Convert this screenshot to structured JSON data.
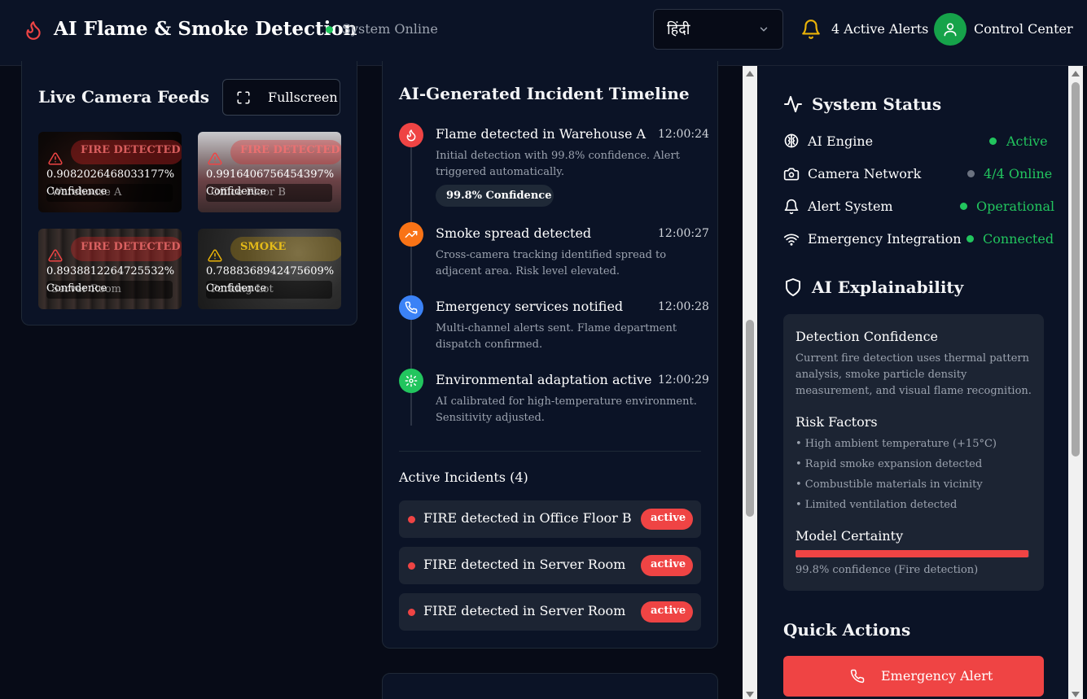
{
  "header": {
    "title": "AI Flame & Smoke Detection",
    "status": "System Online",
    "language": "हिंदी",
    "alerts": "4 Active Alerts",
    "user": "Control Center"
  },
  "cameras": {
    "title": "Live Camera Feeds",
    "fullscreen_label": "Fullscreen",
    "feeds": [
      {
        "badge": "FIRE DETECTED",
        "location": "Warehouse A",
        "confidence": "0.9082026468033177%",
        "confidence_label": "Confidence"
      },
      {
        "badge": "FIRE DETECTED",
        "location": "Office Floor B",
        "confidence": "0.9916406756454397%",
        "confidence_label": "Confidence"
      },
      {
        "badge": "FIRE DETECTED",
        "location": "Server Room",
        "confidence": "0.8938812264725532%",
        "confidence_label": "Confidence"
      },
      {
        "badge": "SMOKE",
        "location": "Parking Lot",
        "confidence": "0.7888368942475609%",
        "confidence_label": "Confidence"
      }
    ]
  },
  "timeline": {
    "title": "AI-Generated Incident Timeline",
    "events": [
      {
        "title": "Flame detected in Warehouse A",
        "time": "12:00:24",
        "desc": "Initial detection with 99.8% confidence. Alert triggered automatically.",
        "badge": "99.8% Confidence",
        "color": "#ef4444",
        "icon": "flame-icon"
      },
      {
        "title": "Smoke spread detected",
        "time": "12:00:27",
        "desc": "Cross-camera tracking identified spread to adjacent area. Risk level elevated.",
        "color": "#f97316",
        "icon": "trending-up-icon"
      },
      {
        "title": "Emergency services notified",
        "time": "12:00:28",
        "desc": "Multi-channel alerts sent. Flame department dispatch confirmed.",
        "color": "#3b82f6",
        "icon": "phone-icon"
      },
      {
        "title": "Environmental adaptation active",
        "time": "12:00:29",
        "desc": "AI calibrated for high-temperature environment. Sensitivity adjusted.",
        "color": "#22c55e",
        "icon": "gear-icon"
      }
    ]
  },
  "incidents": {
    "title": "Active Incidents (4)",
    "items": [
      {
        "text": "FIRE detected in Office Floor B",
        "status": "active"
      },
      {
        "text": "FIRE detected in Server Room",
        "status": "active"
      },
      {
        "text": "FIRE detected in Server Room",
        "status": "active"
      }
    ]
  },
  "system_status": {
    "title": "System Status",
    "items": [
      {
        "label": "AI Engine",
        "value": "Active",
        "dot": "#22c55e"
      },
      {
        "label": "Camera Network",
        "value": "4/4 Online",
        "dot": "#6b7280"
      },
      {
        "label": "Alert System",
        "value": "Operational",
        "dot": "#22c55e"
      },
      {
        "label": "Emergency Integration",
        "value": "Connected",
        "dot": "#22c55e"
      }
    ]
  },
  "explainability": {
    "title": "AI Explainability",
    "detection_title": "Detection Confidence",
    "detection_text": "Current fire detection uses thermal pattern analysis, smoke particle density measurement, and visual flame recognition.",
    "risk_title": "Risk Factors",
    "risk_items": [
      "• High ambient temperature (+15°C)",
      "• Rapid smoke expansion detected",
      "• Combustible materials in vicinity",
      "• Limited ventilation detected"
    ],
    "certainty_title": "Model Certainty",
    "certainty_value": 99.8,
    "certainty_text": "99.8% confidence (Fire detection)"
  },
  "quick_actions": {
    "title": "Quick Actions",
    "emergency_label": "Emergency Alert"
  },
  "colors": {
    "accent_red": "#ef4444",
    "online_green": "#22c55e",
    "panel_bg": "#0b1326"
  }
}
